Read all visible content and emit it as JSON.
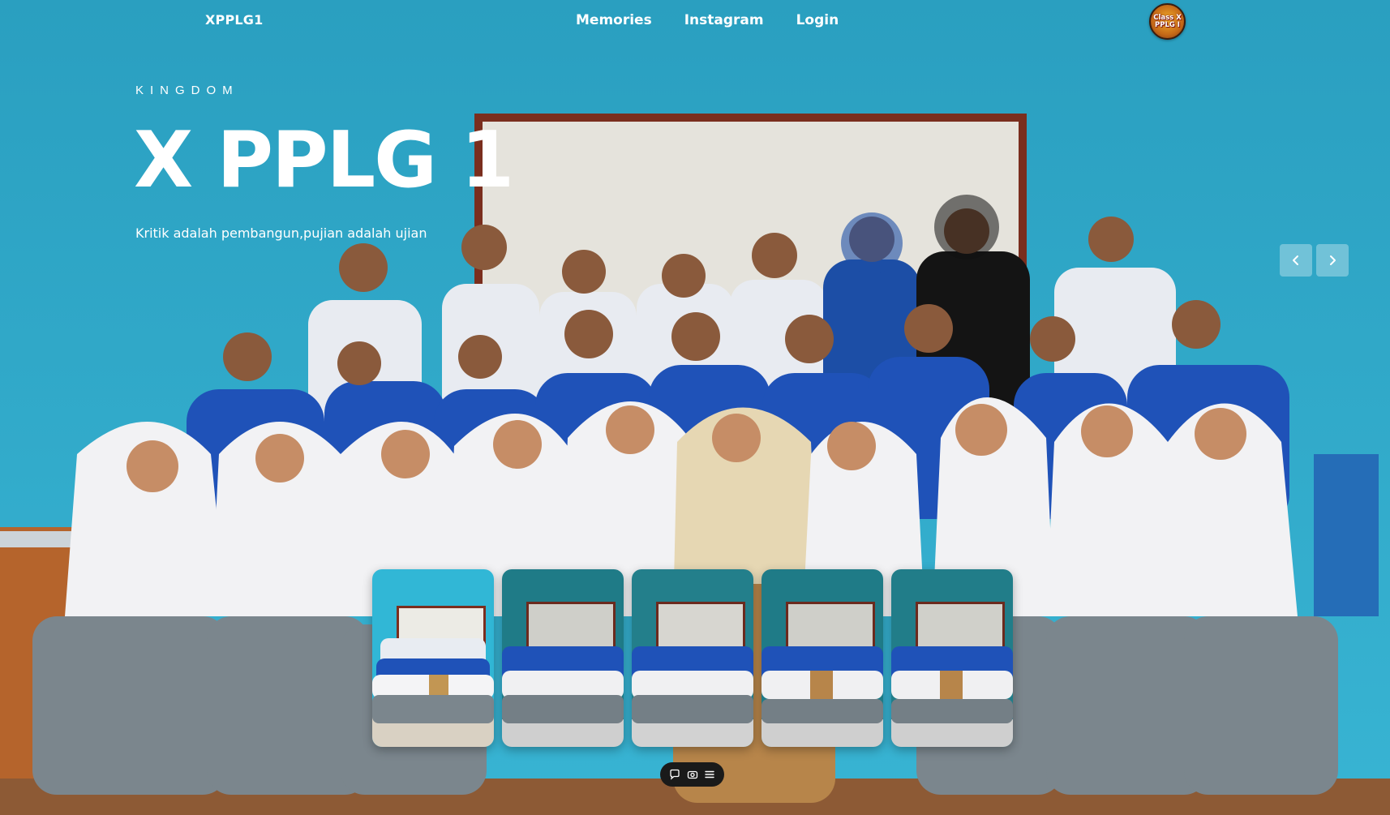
{
  "nav": {
    "brand": "XPPLG1",
    "links": [
      {
        "label": "Memories"
      },
      {
        "label": "Instagram"
      },
      {
        "label": "Login"
      }
    ],
    "logo": {
      "line1": "Class X",
      "line2": "PPLG I"
    }
  },
  "hero": {
    "eyebrow": "KINGDOM",
    "title": "X PPLG 1",
    "tagline": "Kritik adalah pembangun,pujian adalah ujian",
    "background_image": "class-group-photo"
  },
  "carousel": {
    "prev_icon": "chevron-left-icon",
    "next_icon": "chevron-right-icon",
    "thumbnails": [
      {
        "image": "group-photo-1",
        "active": true
      },
      {
        "image": "group-photo-2",
        "active": false
      },
      {
        "image": "group-photo-3",
        "active": false
      },
      {
        "image": "group-photo-4",
        "active": false
      },
      {
        "image": "group-photo-5",
        "active": false
      }
    ]
  },
  "toolbar": {
    "icons": [
      "comment-icon",
      "camera-icon",
      "menu-icon"
    ]
  },
  "colors": {
    "wall": "#2aa3c3",
    "text": "#ffffff",
    "arrow_bg": "rgba(255,255,255,0.32)",
    "toolbar_bg": "#1a1a1a"
  }
}
